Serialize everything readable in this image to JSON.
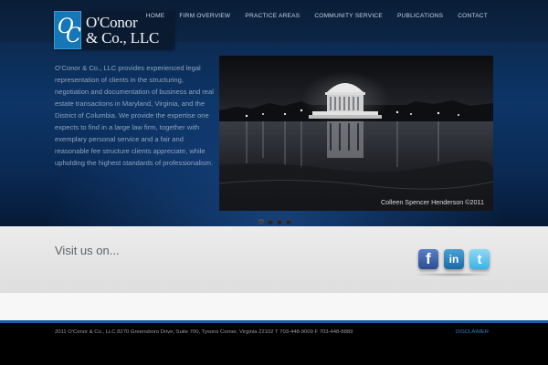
{
  "brand": {
    "logo_monogram": "OC",
    "logo_line1": "O'Conor",
    "logo_line2": "& Co., LLC"
  },
  "nav": {
    "items": [
      "HOME",
      "FIRM OVERVIEW",
      "PRACTICE AREAS",
      "COMMUNITY SERVICE",
      "PUBLICATIONS",
      "CONTACT"
    ]
  },
  "intro": {
    "text": "O'Conor & Co., LLC provides experienced legal representation of clients in the structuring, negotiation and documentation of business and real estate transactions in Maryland, Virginia, and the District of Columbia. We provide the expertise one expects to find in a large law firm, together with exemplary personal service and a fair and reasonable fee structure clients appreciate, while upholding the highest standards of professionalism."
  },
  "slideshow": {
    "photo_credit": "Colleen Spencer Henderson ©2011",
    "slide_count": 4,
    "active_slide": 1
  },
  "social": {
    "label": "Visit us on...",
    "icons": [
      "facebook-icon",
      "linkedin-icon",
      "twitter-icon"
    ]
  },
  "footer": {
    "copyright": "2011 O'Conor & Co., LLC 8270 Greensboro Drive, Suite 700, Tysons Corner, Virginia 22102 T 703-448-9009 F 703-448-8889",
    "disclaimer": "DISCLAIMER"
  },
  "colors": {
    "accent_blue": "#1d5ca8",
    "link_blue": "#2f7fcc",
    "logo_blue": "#1577b6"
  }
}
